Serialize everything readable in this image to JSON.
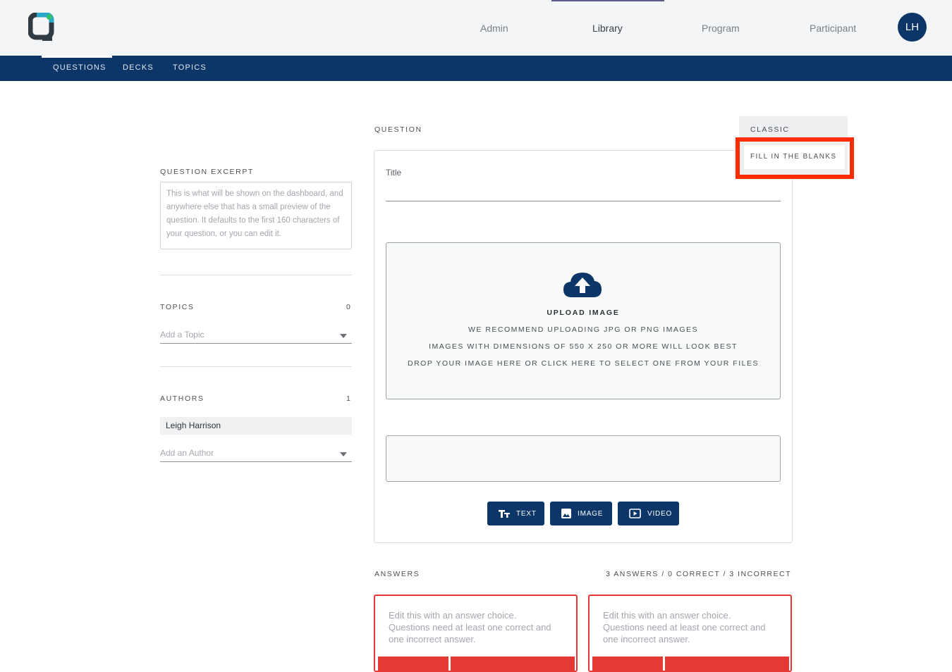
{
  "header": {
    "nav": [
      "Admin",
      "Library",
      "Program",
      "Participant"
    ],
    "active_nav": "Library",
    "avatar_initials": "LH"
  },
  "subnav": [
    "QUESTIONS",
    "DECKS",
    "TOPICS"
  ],
  "sidebar": {
    "excerpt_label": "QUESTION EXCERPT",
    "excerpt_placeholder": "This is what will be shown on the dashboard, and anywhere else that has a small preview of the question. It defaults to the first 160 characters of your question, or you can edit it.",
    "topics_label": "TOPICS",
    "topics_count": "0",
    "topics_placeholder": "Add a Topic",
    "authors_label": "AUTHORS",
    "authors_count": "1",
    "author_name": "Leigh Harrison",
    "authors_placeholder": "Add an Author"
  },
  "question": {
    "label": "QUESTION",
    "type_options": [
      "CLASSIC",
      "FILL IN THE BLANKS"
    ],
    "title_label": "Title",
    "upload": {
      "title": "UPLOAD IMAGE",
      "lines": [
        "WE RECOMMEND UPLOADING JPG OR PNG IMAGES",
        "IMAGES WITH DIMENSIONS OF 550 X 250 OR MORE WILL LOOK BEST",
        "DROP YOUR IMAGE HERE OR CLICK HERE TO SELECT ONE FROM YOUR FILES"
      ]
    },
    "buttons": {
      "text": "TEXT",
      "image": "IMAGE",
      "video": "VIDEO"
    }
  },
  "answers": {
    "label": "ANSWERS",
    "summary": "3 ANSWERS / 0 CORRECT / 3 INCORRECT",
    "placeholder": "Edit this with an answer choice. Questions need at least one correct and one incorrect answer."
  },
  "colors": {
    "brand": "#0c3668",
    "highlight": "#fe2b00",
    "incorrect": "#e53935"
  }
}
